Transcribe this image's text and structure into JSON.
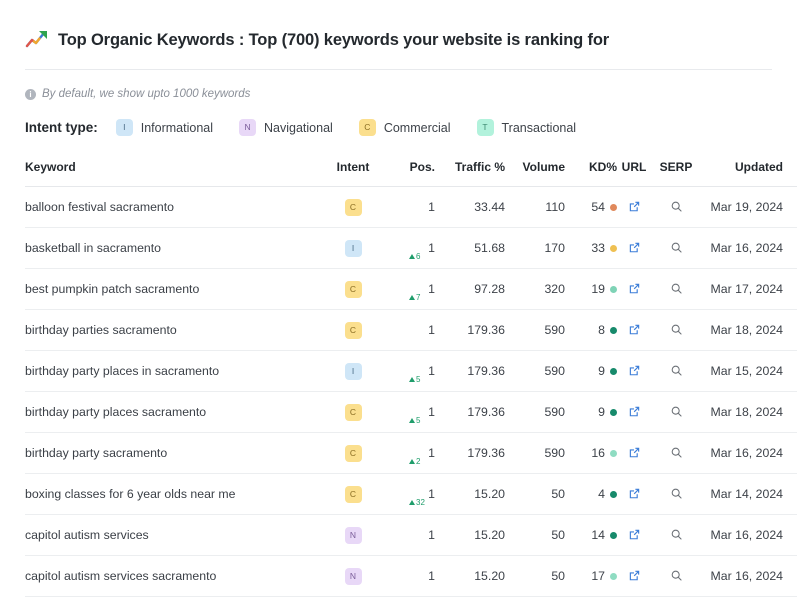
{
  "header": {
    "icon": "chart-increasing-icon",
    "title": "Top Organic Keywords : Top (700) keywords your website is ranking for"
  },
  "note": {
    "icon": "info-icon",
    "text": "By default, we show upto 1000 keywords"
  },
  "legend": {
    "label": "Intent type:",
    "items": [
      {
        "code": "I",
        "label": "Informational",
        "badge_bg": "#cfe6f7",
        "badge_fg": "#4b6b85"
      },
      {
        "code": "N",
        "label": "Navigational",
        "badge_bg": "#e8d8f7",
        "badge_fg": "#7a5c99"
      },
      {
        "code": "C",
        "label": "Commercial",
        "badge_bg": "#fbdf8e",
        "badge_fg": "#8a6d23"
      },
      {
        "code": "T",
        "label": "Transactional",
        "badge_bg": "#b2f2dc",
        "badge_fg": "#3d8b72"
      }
    ]
  },
  "table": {
    "columns": {
      "keyword": "Keyword",
      "intent": "Intent",
      "pos": "Pos.",
      "traffic": "Traffic %",
      "volume": "Volume",
      "kd": "KD%",
      "url": "URL",
      "serp": "SERP",
      "updated": "Updated"
    },
    "icons": {
      "url": "external-link-icon",
      "serp": "search-icon"
    },
    "rows": [
      {
        "keyword": "balloon festival sacramento",
        "intent": "C",
        "pos": "1",
        "pos_delta": "",
        "traffic": "33.44",
        "volume": "110",
        "kd": "54",
        "kd_color": "#e0895c",
        "updated": "Mar 19, 2024"
      },
      {
        "keyword": "basketball in sacramento",
        "intent": "I",
        "pos": "1",
        "pos_delta": "6",
        "traffic": "51.68",
        "volume": "170",
        "kd": "33",
        "kd_color": "#efc052",
        "updated": "Mar 16, 2024"
      },
      {
        "keyword": "best pumpkin patch sacramento",
        "intent": "C",
        "pos": "1",
        "pos_delta": "7",
        "traffic": "97.28",
        "volume": "320",
        "kd": "19",
        "kd_color": "#7fd3b6",
        "updated": "Mar 17, 2024"
      },
      {
        "keyword": "birthday parties sacramento",
        "intent": "C",
        "pos": "1",
        "pos_delta": "",
        "traffic": "179.36",
        "volume": "590",
        "kd": "8",
        "kd_color": "#178a6b",
        "updated": "Mar 18, 2024"
      },
      {
        "keyword": "birthday party places in sacramento",
        "intent": "I",
        "pos": "1",
        "pos_delta": "5",
        "traffic": "179.36",
        "volume": "590",
        "kd": "9",
        "kd_color": "#178a6b",
        "updated": "Mar 15, 2024"
      },
      {
        "keyword": "birthday party places sacramento",
        "intent": "C",
        "pos": "1",
        "pos_delta": "5",
        "traffic": "179.36",
        "volume": "590",
        "kd": "9",
        "kd_color": "#178a6b",
        "updated": "Mar 18, 2024"
      },
      {
        "keyword": "birthday party sacramento",
        "intent": "C",
        "pos": "1",
        "pos_delta": "2",
        "traffic": "179.36",
        "volume": "590",
        "kd": "16",
        "kd_color": "#8fdcc2",
        "updated": "Mar 16, 2024"
      },
      {
        "keyword": "boxing classes for 6 year olds near me",
        "intent": "C",
        "pos": "1",
        "pos_delta": "32",
        "traffic": "15.20",
        "volume": "50",
        "kd": "4",
        "kd_color": "#178a6b",
        "updated": "Mar 14, 2024"
      },
      {
        "keyword": "capitol autism services",
        "intent": "N",
        "pos": "1",
        "pos_delta": "",
        "traffic": "15.20",
        "volume": "50",
        "kd": "14",
        "kd_color": "#178a6b",
        "updated": "Mar 16, 2024"
      },
      {
        "keyword": "capitol autism services sacramento",
        "intent": "N",
        "pos": "1",
        "pos_delta": "",
        "traffic": "15.20",
        "volume": "50",
        "kd": "17",
        "kd_color": "#8fdcc2",
        "updated": "Mar 16, 2024"
      }
    ]
  }
}
